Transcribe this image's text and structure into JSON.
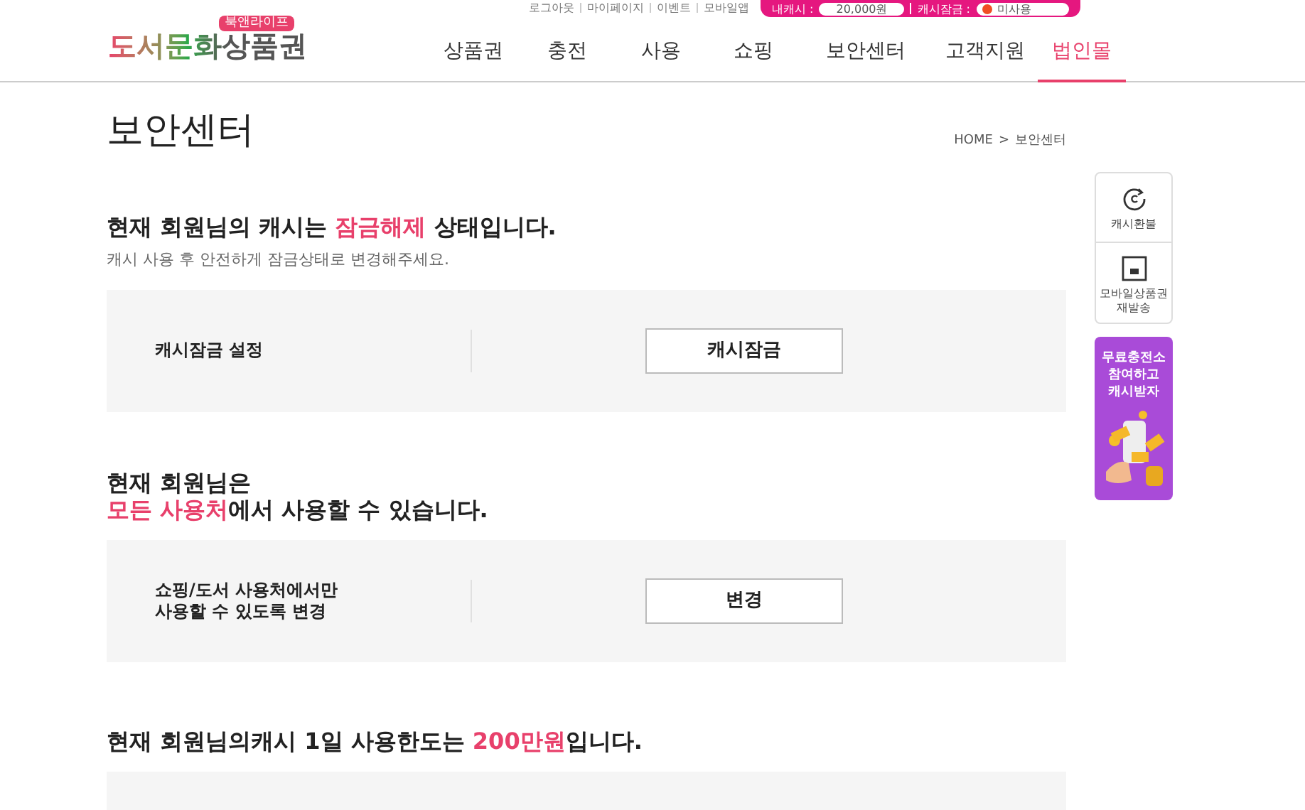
{
  "utility_links": [
    "로그아웃",
    "마이페이지",
    "이벤트",
    "모바일앱"
  ],
  "cash_bar": {
    "cash_label": "내캐시 :",
    "cash_value": "20,000원",
    "lock_label": "캐시잠금 :",
    "lock_value": "미사용"
  },
  "logo": {
    "badge": "북앤라이프",
    "text": "도서문화상품권"
  },
  "nav": [
    {
      "label": "상품권",
      "selected": false
    },
    {
      "label": "충전",
      "selected": false
    },
    {
      "label": "사용",
      "selected": false
    },
    {
      "label": "쇼핑",
      "selected": false
    },
    {
      "label": "보안센터",
      "selected": false
    },
    {
      "label": "고객지원",
      "selected": false
    },
    {
      "label": "법인몰",
      "selected": true
    }
  ],
  "page_title": "보안센터",
  "breadcrumb": [
    "HOME",
    ">",
    "보안센터"
  ],
  "sections": [
    {
      "heading": [
        [
          {
            "text": "현재 회원님의 캐시는 ",
            "highlight": false
          },
          {
            "text": "잠금해제",
            "highlight": true
          },
          {
            "text": " 상태입니다.",
            "highlight": false
          }
        ]
      ],
      "subtext": "캐시 사용 후 안전하게 잠금상태로 변경해주세요.",
      "panel": {
        "label": [
          "캐시잠금 설정"
        ],
        "button": "캐시잠금"
      }
    },
    {
      "heading": [
        [
          {
            "text": "현재 회원님은",
            "highlight": false
          }
        ],
        [
          {
            "text": "모든 사용처",
            "highlight": true
          },
          {
            "text": "에서 사용할 수 있습니다.",
            "highlight": false
          }
        ]
      ],
      "panel": {
        "label": [
          "쇼핑/도서 사용처에서만",
          "사용할 수 있도록 변경"
        ],
        "button": "변경"
      }
    },
    {
      "heading": [
        [
          {
            "text": "현재 회원님의캐시 1일 사용한도는 ",
            "highlight": false
          },
          {
            "text": "200만원",
            "highlight": true
          },
          {
            "text": "입니다.",
            "highlight": false
          }
        ]
      ]
    }
  ],
  "quick_menu": [
    {
      "kind": "refund",
      "label": "캐시환불"
    },
    {
      "kind": "mobile",
      "label": "모바일상품권\n재발송"
    }
  ],
  "banner": {
    "text": "무료충전소\n참여하고\n캐시받자"
  }
}
